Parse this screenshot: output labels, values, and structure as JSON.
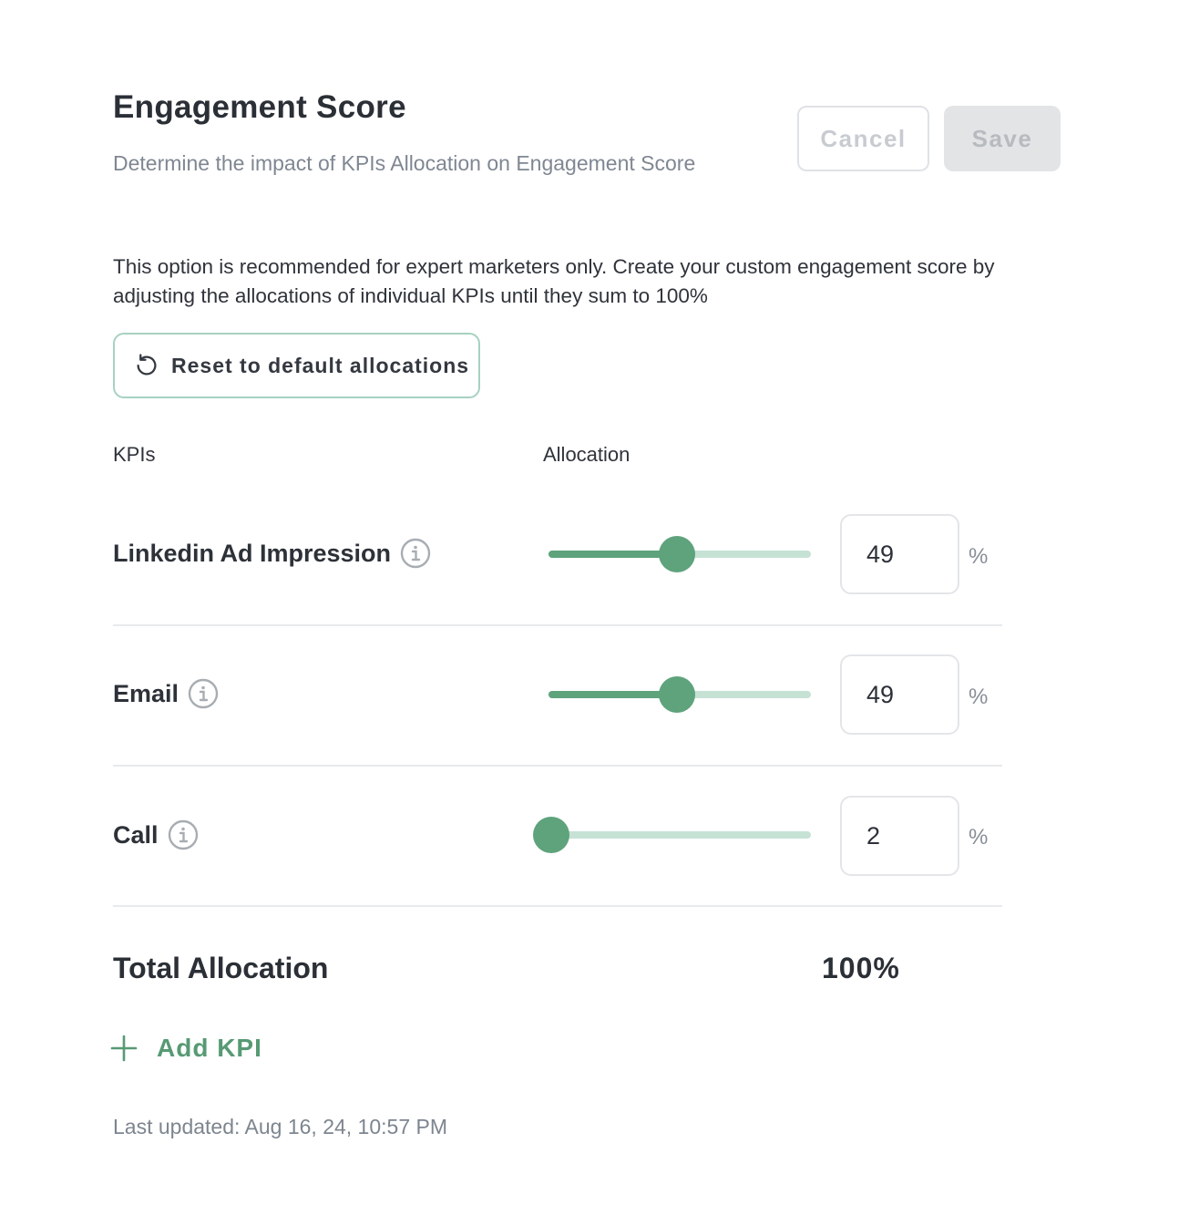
{
  "header": {
    "title": "Engagement Score",
    "subtitle": "Determine the impact of KPIs Allocation on Engagement Score",
    "cancel_label": "Cancel",
    "save_label": "Save"
  },
  "description": "This option is recommended for expert marketers only. Create your custom engagement score by adjusting the allocations of individual KPIs until they sum to 100%",
  "reset": {
    "label": "Reset to default allocations",
    "icon": "reset-icon"
  },
  "columns": {
    "kpis": "KPIs",
    "allocation": "Allocation"
  },
  "kpis": [
    {
      "label": "Linkedin Ad Impression",
      "value": "49",
      "unit": "%",
      "slider_fraction": 0.49,
      "icon": "info-icon"
    },
    {
      "label": "Email",
      "value": "49",
      "unit": "%",
      "slider_fraction": 0.49,
      "icon": "info-icon"
    },
    {
      "label": "Call",
      "value": "2",
      "unit": "%",
      "slider_fraction": 0.01,
      "icon": "info-icon"
    }
  ],
  "total": {
    "label": "Total Allocation",
    "value": "100%"
  },
  "add_kpi": {
    "label": "Add KPI",
    "icon": "plus-icon"
  },
  "last_updated": "Last updated: Aug 16, 24, 10:57 PM",
  "colors": {
    "accent": "#5ea37c",
    "accent_light": "#c6e2d4",
    "border_accent": "#a7d1c0",
    "muted_text": "#7f8792"
  }
}
